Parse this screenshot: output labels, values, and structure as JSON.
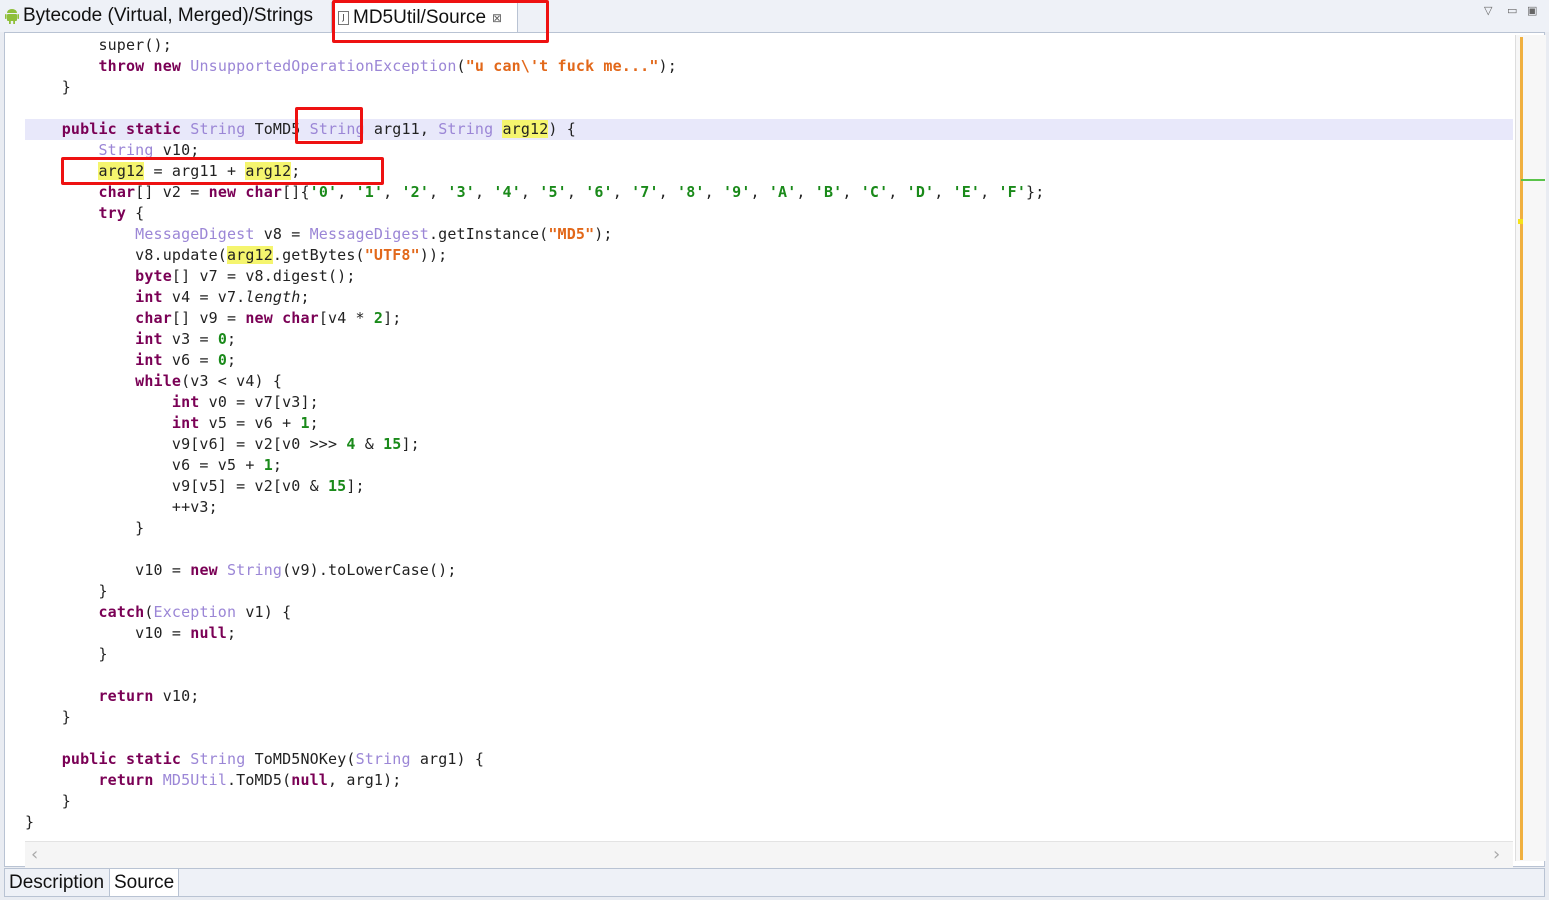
{
  "tabs": [
    {
      "label": "Bytecode (Virtual, Merged)/Strings",
      "icon": "android-icon"
    },
    {
      "label": "MD5Util/Source",
      "icon": "java-file-icon",
      "close": "⊠"
    }
  ],
  "window_controls": {
    "minimize": "▽",
    "restore": "▭",
    "maximize": "▣"
  },
  "bottom_tabs": [
    "Description",
    "Source"
  ],
  "code": {
    "highlight": "arg12",
    "lines": [
      "        super();",
      "        throw new UnsupportedOperationException(\"u can\\'t fuck me...\");",
      "    }",
      "",
      "    public static String ToMD5 String arg11, String arg12) {",
      "        String v10;",
      "        arg12 = arg11 + arg12;",
      "        char[] v2 = new char[]{'0', '1', '2', '3', '4', '5', '6', '7', '8', '9', 'A', 'B', 'C', 'D', 'E', 'F'};",
      "        try {",
      "            MessageDigest v8 = MessageDigest.getInstance(\"MD5\");",
      "            v8.update(arg12.getBytes(\"UTF8\"));",
      "            byte[] v7 = v8.digest();",
      "            int v4 = v7.length;",
      "            char[] v9 = new char[v4 * 2];",
      "            int v3 = 0;",
      "            int v6 = 0;",
      "            while(v3 < v4) {",
      "                int v0 = v7[v3];",
      "                int v5 = v6 + 1;",
      "                v9[v6] = v2[v0 >>> 4 & 15];",
      "                v6 = v5 + 1;",
      "                v9[v5] = v2[v0 & 15];",
      "                ++v3;",
      "            }",
      "",
      "            v10 = new String(v9).toLowerCase();",
      "        }",
      "        catch(Exception v1) {",
      "            v10 = null;",
      "        }",
      "",
      "        return v10;",
      "    }",
      "",
      "    public static String ToMD5NOKey(String arg1) {",
      "        return MD5Util.ToMD5(null, arg1);",
      "    }",
      "}"
    ]
  },
  "colors": {
    "keyword": "#7a0055",
    "type": "#9b86d6",
    "string": "#e2681a",
    "number": "#1a8a1a",
    "highlight": "#f5f56e",
    "annotation_box": "#ee1111"
  }
}
